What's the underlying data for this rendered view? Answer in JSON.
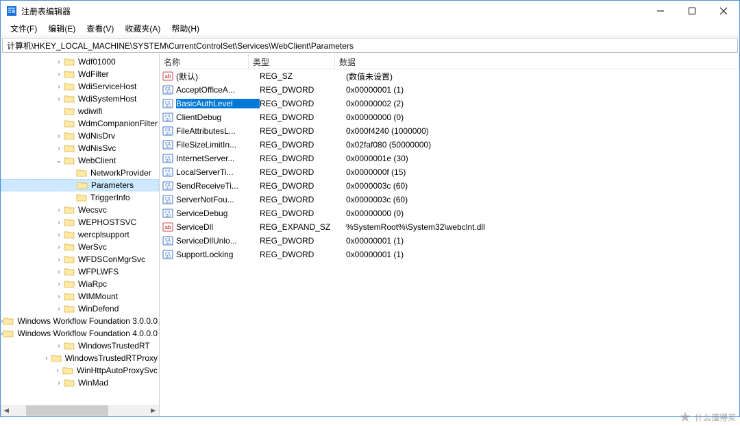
{
  "title": "注册表编辑器",
  "menubar": [
    "文件(F)",
    "编辑(E)",
    "查看(V)",
    "收藏夹(A)",
    "帮助(H)"
  ],
  "address_path": "计算机\\HKEY_LOCAL_MACHINE\\SYSTEM\\CurrentControlSet\\Services\\WebClient\\Parameters",
  "tree": [
    {
      "depth": 3,
      "exp": "closed",
      "label": "Wdf01000"
    },
    {
      "depth": 3,
      "exp": "closed",
      "label": "WdFilter"
    },
    {
      "depth": 3,
      "exp": "closed",
      "label": "WdiServiceHost"
    },
    {
      "depth": 3,
      "exp": "closed",
      "label": "WdiSystemHost"
    },
    {
      "depth": 3,
      "exp": "none",
      "label": "wdiwifi"
    },
    {
      "depth": 3,
      "exp": "none",
      "label": "WdmCompanionFilter"
    },
    {
      "depth": 3,
      "exp": "closed",
      "label": "WdNisDrv"
    },
    {
      "depth": 3,
      "exp": "closed",
      "label": "WdNisSvc"
    },
    {
      "depth": 3,
      "exp": "open",
      "label": "WebClient"
    },
    {
      "depth": 4,
      "exp": "none",
      "label": "NetworkProvider"
    },
    {
      "depth": 4,
      "exp": "none",
      "label": "Parameters",
      "selected": true
    },
    {
      "depth": 4,
      "exp": "none",
      "label": "TriggerInfo"
    },
    {
      "depth": 3,
      "exp": "closed",
      "label": "Wecsvc"
    },
    {
      "depth": 3,
      "exp": "closed",
      "label": "WEPHOSTSVC"
    },
    {
      "depth": 3,
      "exp": "closed",
      "label": "wercplsupport"
    },
    {
      "depth": 3,
      "exp": "closed",
      "label": "WerSvc"
    },
    {
      "depth": 3,
      "exp": "closed",
      "label": "WFDSConMgrSvc"
    },
    {
      "depth": 3,
      "exp": "closed",
      "label": "WFPLWFS"
    },
    {
      "depth": 3,
      "exp": "closed",
      "label": "WiaRpc"
    },
    {
      "depth": 3,
      "exp": "closed",
      "label": "WIMMount"
    },
    {
      "depth": 3,
      "exp": "closed",
      "label": "WinDefend"
    },
    {
      "depth": 3,
      "exp": "closed",
      "label": "Windows Workflow Foundation 3.0.0.0"
    },
    {
      "depth": 3,
      "exp": "closed",
      "label": "Windows Workflow Foundation 4.0.0.0"
    },
    {
      "depth": 3,
      "exp": "closed",
      "label": "WindowsTrustedRT"
    },
    {
      "depth": 3,
      "exp": "closed",
      "label": "WindowsTrustedRTProxy"
    },
    {
      "depth": 3,
      "exp": "closed",
      "label": "WinHttpAutoProxySvc"
    },
    {
      "depth": 3,
      "exp": "closed",
      "label": "WinMad"
    }
  ],
  "columns": {
    "name": "名称",
    "type": "类型",
    "data": "数据"
  },
  "values": [
    {
      "icon": "str",
      "name": "(默认)",
      "type": "REG_SZ",
      "data": "(数值未设置)"
    },
    {
      "icon": "bin",
      "name": "AcceptOfficeA...",
      "type": "REG_DWORD",
      "data": "0x00000001 (1)"
    },
    {
      "icon": "bin",
      "name": "BasicAuthLevel",
      "type": "REG_DWORD",
      "data": "0x00000002 (2)",
      "selected": true
    },
    {
      "icon": "bin",
      "name": "ClientDebug",
      "type": "REG_DWORD",
      "data": "0x00000000 (0)"
    },
    {
      "icon": "bin",
      "name": "FileAttributesL...",
      "type": "REG_DWORD",
      "data": "0x000f4240 (1000000)"
    },
    {
      "icon": "bin",
      "name": "FileSizeLimitIn...",
      "type": "REG_DWORD",
      "data": "0x02faf080 (50000000)"
    },
    {
      "icon": "bin",
      "name": "InternetServer...",
      "type": "REG_DWORD",
      "data": "0x0000001e (30)"
    },
    {
      "icon": "bin",
      "name": "LocalServerTi...",
      "type": "REG_DWORD",
      "data": "0x0000000f (15)"
    },
    {
      "icon": "bin",
      "name": "SendReceiveTi...",
      "type": "REG_DWORD",
      "data": "0x0000003c (60)"
    },
    {
      "icon": "bin",
      "name": "ServerNotFou...",
      "type": "REG_DWORD",
      "data": "0x0000003c (60)"
    },
    {
      "icon": "bin",
      "name": "ServiceDebug",
      "type": "REG_DWORD",
      "data": "0x00000000 (0)"
    },
    {
      "icon": "str",
      "name": "ServiceDll",
      "type": "REG_EXPAND_SZ",
      "data": "%SystemRoot%\\System32\\webclnt.dll"
    },
    {
      "icon": "bin",
      "name": "ServiceDllUnlo...",
      "type": "REG_DWORD",
      "data": "0x00000001 (1)"
    },
    {
      "icon": "bin",
      "name": "SupportLocking",
      "type": "REG_DWORD",
      "data": "0x00000001 (1)"
    }
  ],
  "watermark": "什么值得买"
}
